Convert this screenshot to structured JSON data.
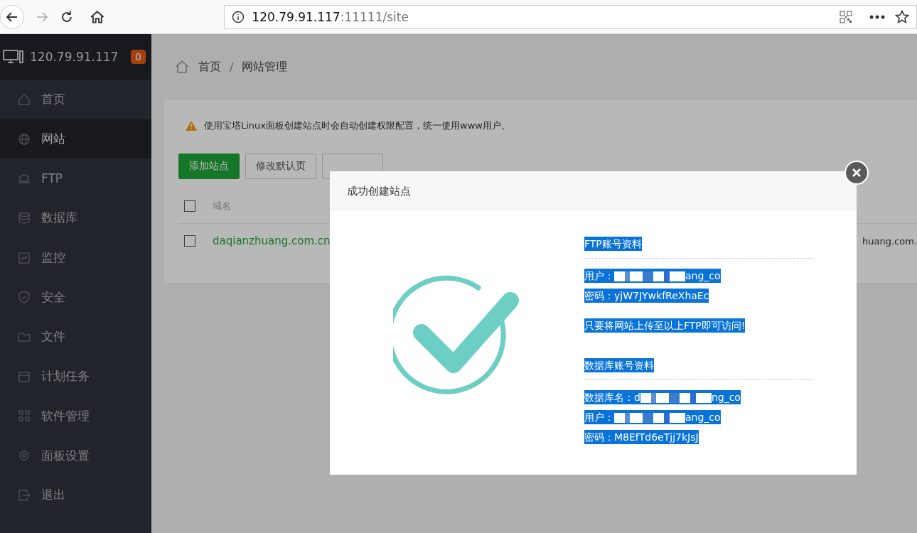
{
  "browser": {
    "url_host": "120.79.91.117",
    "url_rest": ":11111/site"
  },
  "sidebar": {
    "title": "120.79.91.117",
    "badge": "0",
    "items": [
      {
        "label": "首页",
        "selected": false
      },
      {
        "label": "网站",
        "selected": true
      },
      {
        "label": "FTP",
        "selected": false
      },
      {
        "label": "数据库",
        "selected": false
      },
      {
        "label": "监控",
        "selected": false
      },
      {
        "label": "安全",
        "selected": false
      },
      {
        "label": "文件",
        "selected": false
      },
      {
        "label": "计划任务",
        "selected": false
      },
      {
        "label": "软件管理",
        "selected": false
      },
      {
        "label": "面板设置",
        "selected": false
      },
      {
        "label": "退出",
        "selected": false
      }
    ]
  },
  "breadcrumb": [
    "首页",
    "网站管理"
  ],
  "breadcrumb_separator": "/",
  "notice": "使用宝塔Linux面板创建站点时会自动创建权限配置，统一使用www用户。",
  "buttons": [
    {
      "label": "添加站点",
      "kind": "primary"
    },
    {
      "label": "修改默认页",
      "kind": "default"
    },
    {
      "kind": "default"
    }
  ],
  "table": {
    "columns": [
      "域名"
    ],
    "rows": [
      {
        "checked": false,
        "domain": "daqianzhuang.com.cn",
        "column_2": "huang.com."
      }
    ],
    "header_checked": false
  },
  "modal": {
    "title": "成功创建站点",
    "text_selected": true,
    "sections": [
      {
        "heading": "FTP账号资料",
        "lines": [
          {
            "label": "用户：",
            "after": "ang_co",
            "redacted": true
          },
          {
            "label": "密码：",
            "after": "yjW7JYwkfReXhaEc",
            "redacted": false
          }
        ],
        "note": "只要将网站上传至以上FTP即可访问!"
      },
      {
        "heading": "数据库账号资料",
        "lines": [
          {
            "label": "数据库名：",
            "before": "d",
            "after": "ng_co",
            "redacted": true
          },
          {
            "label": "用户：",
            "after": "ang_co",
            "redacted": true
          },
          {
            "label": "密码：",
            "after": "M8EfTd6eTjj7kJsJ",
            "redacted": false
          }
        ]
      }
    ]
  }
}
